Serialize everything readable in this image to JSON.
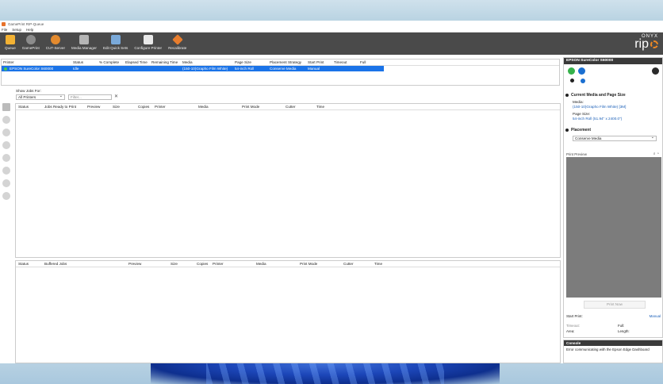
{
  "window": {
    "title": "GamePrint RIP-Queue"
  },
  "menu": [
    "File",
    "Setup",
    "Help"
  ],
  "toolbar": [
    {
      "label": "Queue",
      "icon": "queue-icon"
    },
    {
      "label": "GamePrint",
      "icon": "gameprint-icon"
    },
    {
      "label": "CUT-Server",
      "icon": "cut-server-icon"
    },
    {
      "label": "Media Manager",
      "icon": "media-manager-icon"
    },
    {
      "label": "Edit Quick Sets",
      "icon": "quick-sets-icon"
    },
    {
      "label": "Configure Printer",
      "icon": "printer-icon"
    },
    {
      "label": "Recalibrate",
      "icon": "recalibrate-icon"
    }
  ],
  "logo": {
    "top": "ONYX",
    "main": "rip"
  },
  "printers_table": {
    "columns": [
      "Printer",
      "Status",
      "% Complete",
      "Elapsed Time",
      "Remaining Time",
      "Media",
      "Page Size",
      "Placement Strategy",
      "Start Print",
      "Timeout",
      "Full"
    ],
    "row": [
      "EPSON SureColor S60000",
      "Idle",
      "",
      "",
      "",
      "(150-10)Grapho Film White)",
      "54-inch Roll",
      "Conserve Media",
      "Manual",
      "",
      ""
    ]
  },
  "filter": {
    "label": "Show Jobs For:",
    "selected": "All Printers",
    "placeholder": "Filter...",
    "clear": "✕"
  },
  "jobs_table": {
    "columns": [
      "Status",
      "Jobs Ready to Print",
      "Preview",
      "Size",
      "Copies",
      "Printer",
      "Media",
      "Print Mode",
      "Cutter",
      "Time"
    ]
  },
  "buffered_table": {
    "columns": [
      "Status",
      "Buffered Jobs",
      "Preview",
      "Size",
      "Copies",
      "Printer",
      "Media",
      "Print Mode",
      "Cutter",
      "Time"
    ]
  },
  "right_panel": {
    "printer_name": "EPSON SureColor S60000",
    "current_media_title": "Current Media and Page Size",
    "media_label": "Media:",
    "media_value": "(150-10)Grapho Film White) [3M]",
    "page_size_label": "Page Size:",
    "page_size_value": "54-inch Roll (51.94\" x 2400.0\")",
    "placement_title": "Placement",
    "placement_value": "Conserve Media",
    "print_preview_label": "Print Preview",
    "print_now": "Print Now",
    "start_print_label": "Start Print:",
    "start_print_value": "Manual",
    "timeout_label": "Timeout:",
    "full_label": "Full:",
    "area_label": "Area:",
    "length_label": "Length:"
  },
  "console": {
    "title": "Console",
    "message": "Error communicating with the Epson Edge Dashboard"
  }
}
